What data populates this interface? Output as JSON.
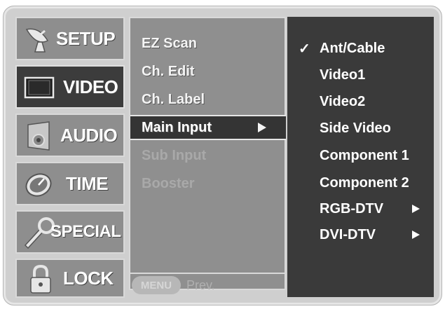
{
  "categories": [
    {
      "label": "SETUP",
      "icon": "satellite-dish-icon",
      "active": false
    },
    {
      "label": "VIDEO",
      "icon": "screen-icon",
      "active": true
    },
    {
      "label": "AUDIO",
      "icon": "speaker-icon",
      "active": false
    },
    {
      "label": "TIME",
      "icon": "clock-icon",
      "active": false
    },
    {
      "label": "SPECIAL",
      "icon": "wrench-icon",
      "active": false
    },
    {
      "label": "LOCK",
      "icon": "padlock-icon",
      "active": false
    }
  ],
  "submenu": {
    "items": [
      {
        "label": "EZ Scan"
      },
      {
        "label": "Ch. Edit"
      },
      {
        "label": "Ch. Label"
      },
      {
        "label": "Main Input",
        "selected": true
      },
      {
        "label": "Sub Input",
        "disabled": true
      },
      {
        "label": "Booster",
        "disabled": true
      }
    ],
    "footer": {
      "button": "MENU",
      "label": "Prev."
    }
  },
  "options": [
    {
      "label": "Ant/Cable",
      "checked": true,
      "check_mark": "✓"
    },
    {
      "label": "Video1"
    },
    {
      "label": "Video2"
    },
    {
      "label": "Side Video"
    },
    {
      "label": "Component 1"
    },
    {
      "label": "Component 2"
    },
    {
      "label": "RGB-DTV",
      "has_submenu": true
    },
    {
      "label": "DVI-DTV",
      "has_submenu": true
    }
  ],
  "colors": {
    "panel_gray": "#8f8f8f",
    "selected_dark": "#343434",
    "frame": "#cfcfcf"
  }
}
